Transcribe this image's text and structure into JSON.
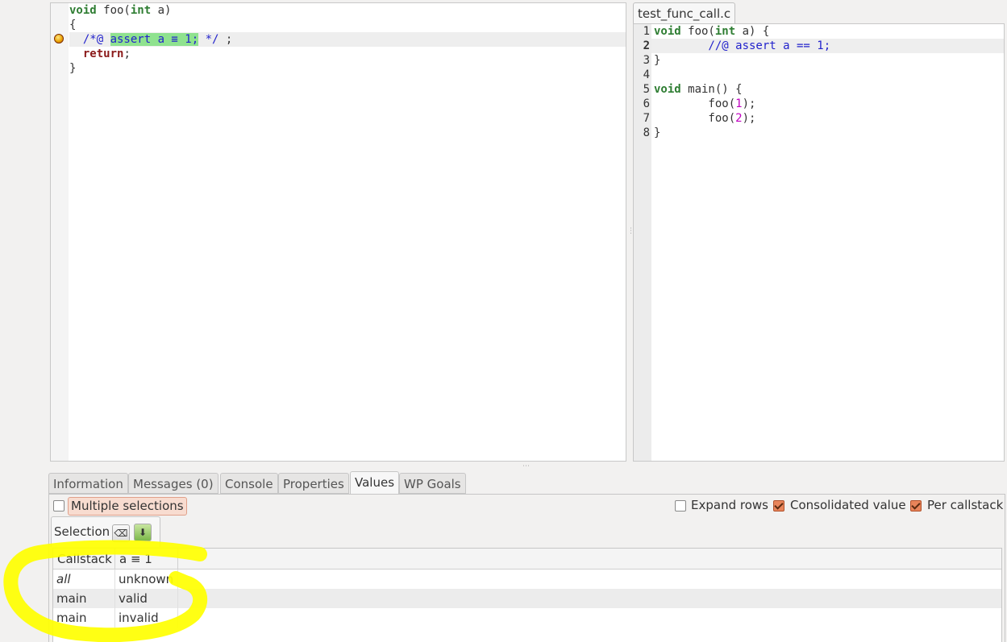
{
  "left_editor": {
    "lines": [
      {
        "parts": [
          {
            "t": "void",
            "c": "kw"
          },
          {
            "t": " foo(",
            "c": ""
          },
          {
            "t": "int",
            "c": "kw"
          },
          {
            "t": " a)",
            "c": ""
          }
        ]
      },
      {
        "parts": [
          {
            "t": "{",
            "c": ""
          }
        ]
      },
      {
        "parts": [
          {
            "t": "  /*@ ",
            "c": "acsl"
          },
          {
            "t": "assert a ≡ 1;",
            "c": "hl-assert"
          },
          {
            "t": " */",
            "c": "acsl"
          },
          {
            "t": " ;",
            "c": ""
          }
        ]
      },
      {
        "parts": [
          {
            "t": "  ",
            "c": ""
          },
          {
            "t": "return",
            "c": "kw2"
          },
          {
            "t": ";",
            "c": ""
          }
        ]
      },
      {
        "parts": [
          {
            "t": "}",
            "c": ""
          }
        ]
      }
    ],
    "marker_icon": "status-bullet-icon"
  },
  "right_editor": {
    "tab_label": "test_func_call.c",
    "lines": [
      {
        "n": "1",
        "parts": [
          {
            "t": "void",
            "c": "kw"
          },
          {
            "t": " foo(",
            "c": ""
          },
          {
            "t": "int",
            "c": "kw"
          },
          {
            "t": " a) {",
            "c": ""
          }
        ]
      },
      {
        "n": "2",
        "parts": [
          {
            "t": "        //@ assert a == 1;",
            "c": "acsl"
          }
        ]
      },
      {
        "n": "3",
        "parts": [
          {
            "t": "}",
            "c": ""
          }
        ]
      },
      {
        "n": "4",
        "parts": [
          {
            "t": "",
            "c": ""
          }
        ]
      },
      {
        "n": "5",
        "parts": [
          {
            "t": "void",
            "c": "kw"
          },
          {
            "t": " main() {",
            "c": ""
          }
        ]
      },
      {
        "n": "6",
        "parts": [
          {
            "t": "        foo(",
            "c": ""
          },
          {
            "t": "1",
            "c": "num"
          },
          {
            "t": ");",
            "c": ""
          }
        ]
      },
      {
        "n": "7",
        "parts": [
          {
            "t": "        foo(",
            "c": ""
          },
          {
            "t": "2",
            "c": "num"
          },
          {
            "t": ");",
            "c": ""
          }
        ]
      },
      {
        "n": "8",
        "parts": [
          {
            "t": "}",
            "c": ""
          }
        ]
      }
    ]
  },
  "bottom_tabs": [
    "Information",
    "Messages (0)",
    "Console",
    "Properties",
    "Values",
    "WP Goals"
  ],
  "active_tab": "Values",
  "values_panel": {
    "multiple_selections": {
      "label": "Multiple selections",
      "checked": false
    },
    "expand_rows": {
      "label": "Expand rows",
      "checked": false
    },
    "consolidated_value": {
      "label": "Consolidated value",
      "checked": true
    },
    "per_callstack": {
      "label": "Per callstack",
      "checked": true
    },
    "selection_label": "Selection",
    "clear_icon": "clear-selection-icon",
    "import_icon": "download-icon",
    "table": {
      "headers": [
        "Callstack",
        "a ≡ 1"
      ],
      "rows": [
        [
          "all",
          "unknown"
        ],
        [
          "main",
          "valid"
        ],
        [
          "main",
          "invalid"
        ]
      ]
    }
  },
  "colors": {
    "annotation_highlight": "#8fe28f",
    "acsl_text": "#2222cc",
    "keyword": "#2e7d32",
    "yellow_annotation": "#ffff00",
    "checkbox_checked": "#e8845a"
  }
}
